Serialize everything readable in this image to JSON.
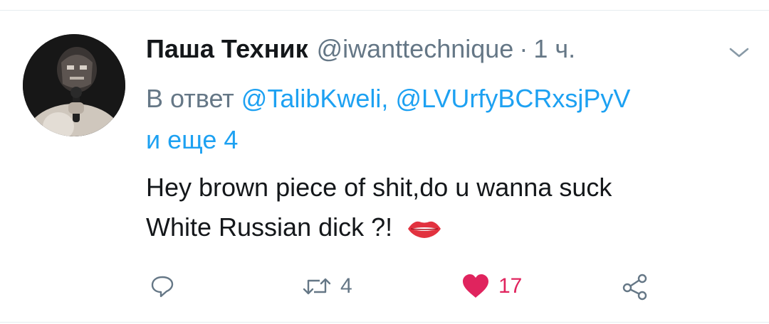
{
  "tweet": {
    "author": {
      "display_name": "Паша Техник",
      "handle": "@iwanttechnique",
      "separator": "·",
      "time": "1 ч."
    },
    "reply": {
      "prefix": "В ответ",
      "mention1": "@TalibKweli,",
      "mention2": "@LVUrfyBCRxsjPyV",
      "more": "и еще 4"
    },
    "text": {
      "line1": "Hey brown piece of shit,do u wanna suck",
      "line2": "White Russian dick ?!",
      "emoji": "lips-emoji"
    },
    "actions": {
      "reply_icon": "reply-icon",
      "retweet_icon": "retweet-icon",
      "retweet_count": "4",
      "like_icon": "heart-icon",
      "like_count": "17",
      "share_icon": "share-icon",
      "liked": true
    },
    "menu_icon": "chevron-down-icon"
  },
  "colors": {
    "text_primary": "#14171a",
    "text_secondary": "#657786",
    "link": "#1da1f2",
    "like": "#e0245e",
    "divider": "#e6ecf0"
  }
}
